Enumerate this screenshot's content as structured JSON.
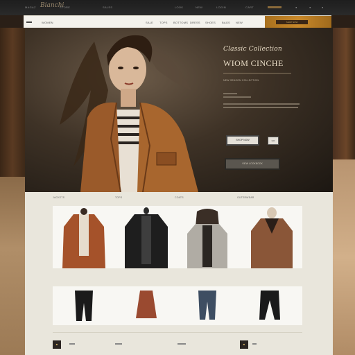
{
  "topbar": {
    "logo": "Bianchi",
    "links": [
      "MAGAZ",
      "STORE",
      "SALES",
      "LOOK",
      "NEW",
      "LOGIN",
      "CART"
    ]
  },
  "navbar": {
    "links": [
      "WOMEN",
      "SALE",
      "TOPS",
      "BOTTOMS",
      "DRESS",
      "SHOES",
      "BAGS",
      "NEW"
    ],
    "promo_button": "SHOP NOW"
  },
  "hero": {
    "script": "Classic Collection",
    "title": "WIOM CINCHE",
    "small": "NEW SEASON COLLECTION",
    "button_primary": "SHOP NOW",
    "button_small": "GO",
    "button_secondary": "VIEW LOOKBOOK"
  },
  "products": {
    "category_labels": [
      "JACKETS",
      "TOPS",
      "COATS",
      "OUTERWEAR"
    ],
    "top_captions": [
      "",
      "",
      "",
      ""
    ],
    "bottom_captions": [
      "",
      "",
      "",
      ""
    ],
    "footer_labels": [
      "",
      "",
      "",
      ""
    ]
  },
  "colors": {
    "accent": "#c9892a",
    "hero_bg": "#3e3226",
    "product_bg": "#e9e6dc"
  }
}
